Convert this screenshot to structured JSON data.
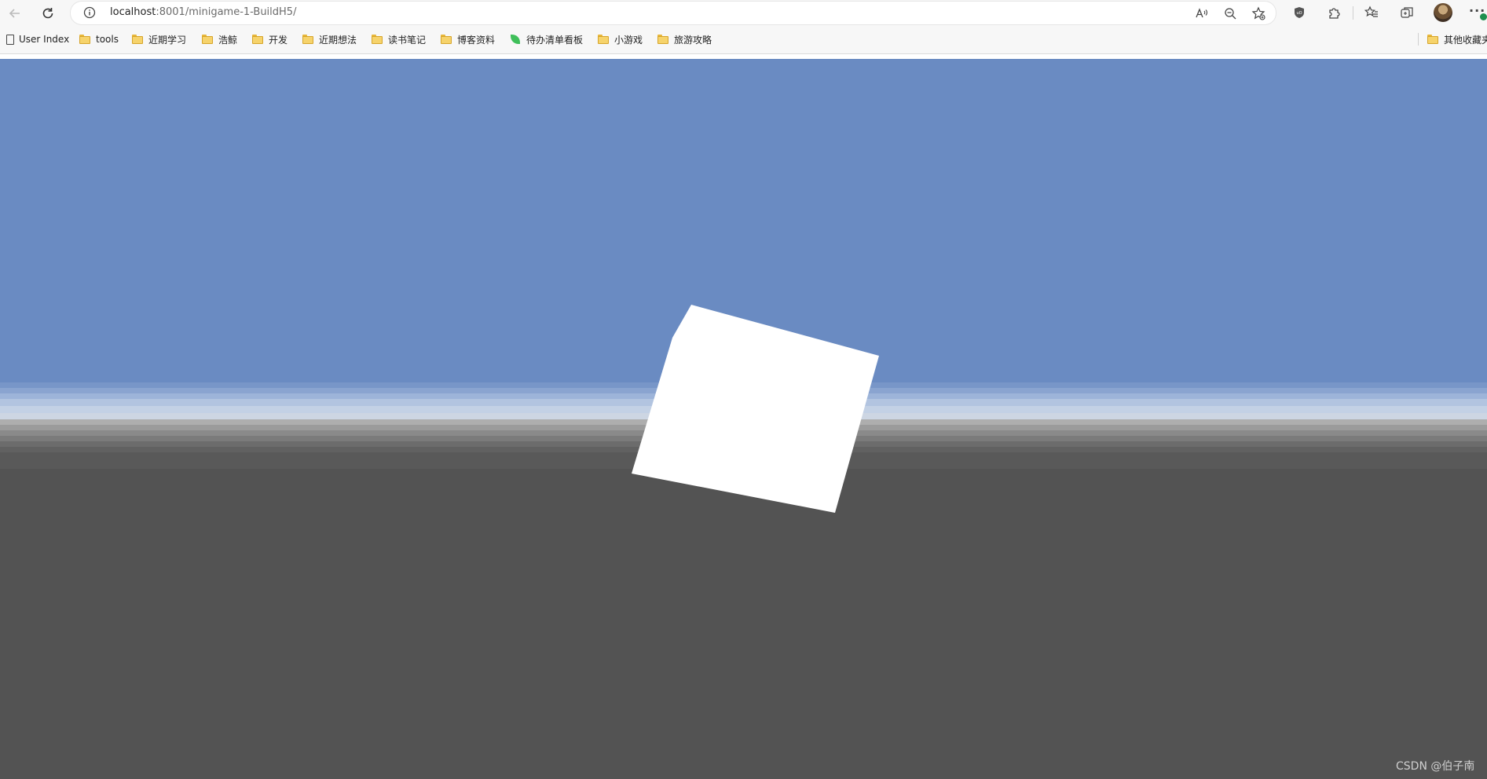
{
  "browser": {
    "url_host": "localhost",
    "url_rest": ":8001/minigame-1-BuildH5/"
  },
  "bookmarks": [
    {
      "label": "User Index",
      "icon": "page-icon"
    },
    {
      "label": "tools",
      "icon": "folder-icon"
    },
    {
      "label": "近期学习",
      "icon": "folder-icon"
    },
    {
      "label": "浩鲸",
      "icon": "folder-icon"
    },
    {
      "label": "开发",
      "icon": "folder-icon"
    },
    {
      "label": "近期想法",
      "icon": "folder-icon"
    },
    {
      "label": "读书笔记",
      "icon": "folder-icon"
    },
    {
      "label": "博客资料",
      "icon": "folder-icon"
    },
    {
      "label": "待办清单看板",
      "icon": "leaf-icon"
    },
    {
      "label": "小游戏",
      "icon": "folder-icon"
    },
    {
      "label": "旅游攻略",
      "icon": "folder-icon"
    }
  ],
  "other_bookmarks": {
    "label": "其他收藏夹",
    "icon": "folder-icon"
  },
  "scene": {
    "sky_color": "#6a8bc2",
    "ground_color": "#535353",
    "cube_color": "#ffffff"
  },
  "watermark": "CSDN @伯子南"
}
